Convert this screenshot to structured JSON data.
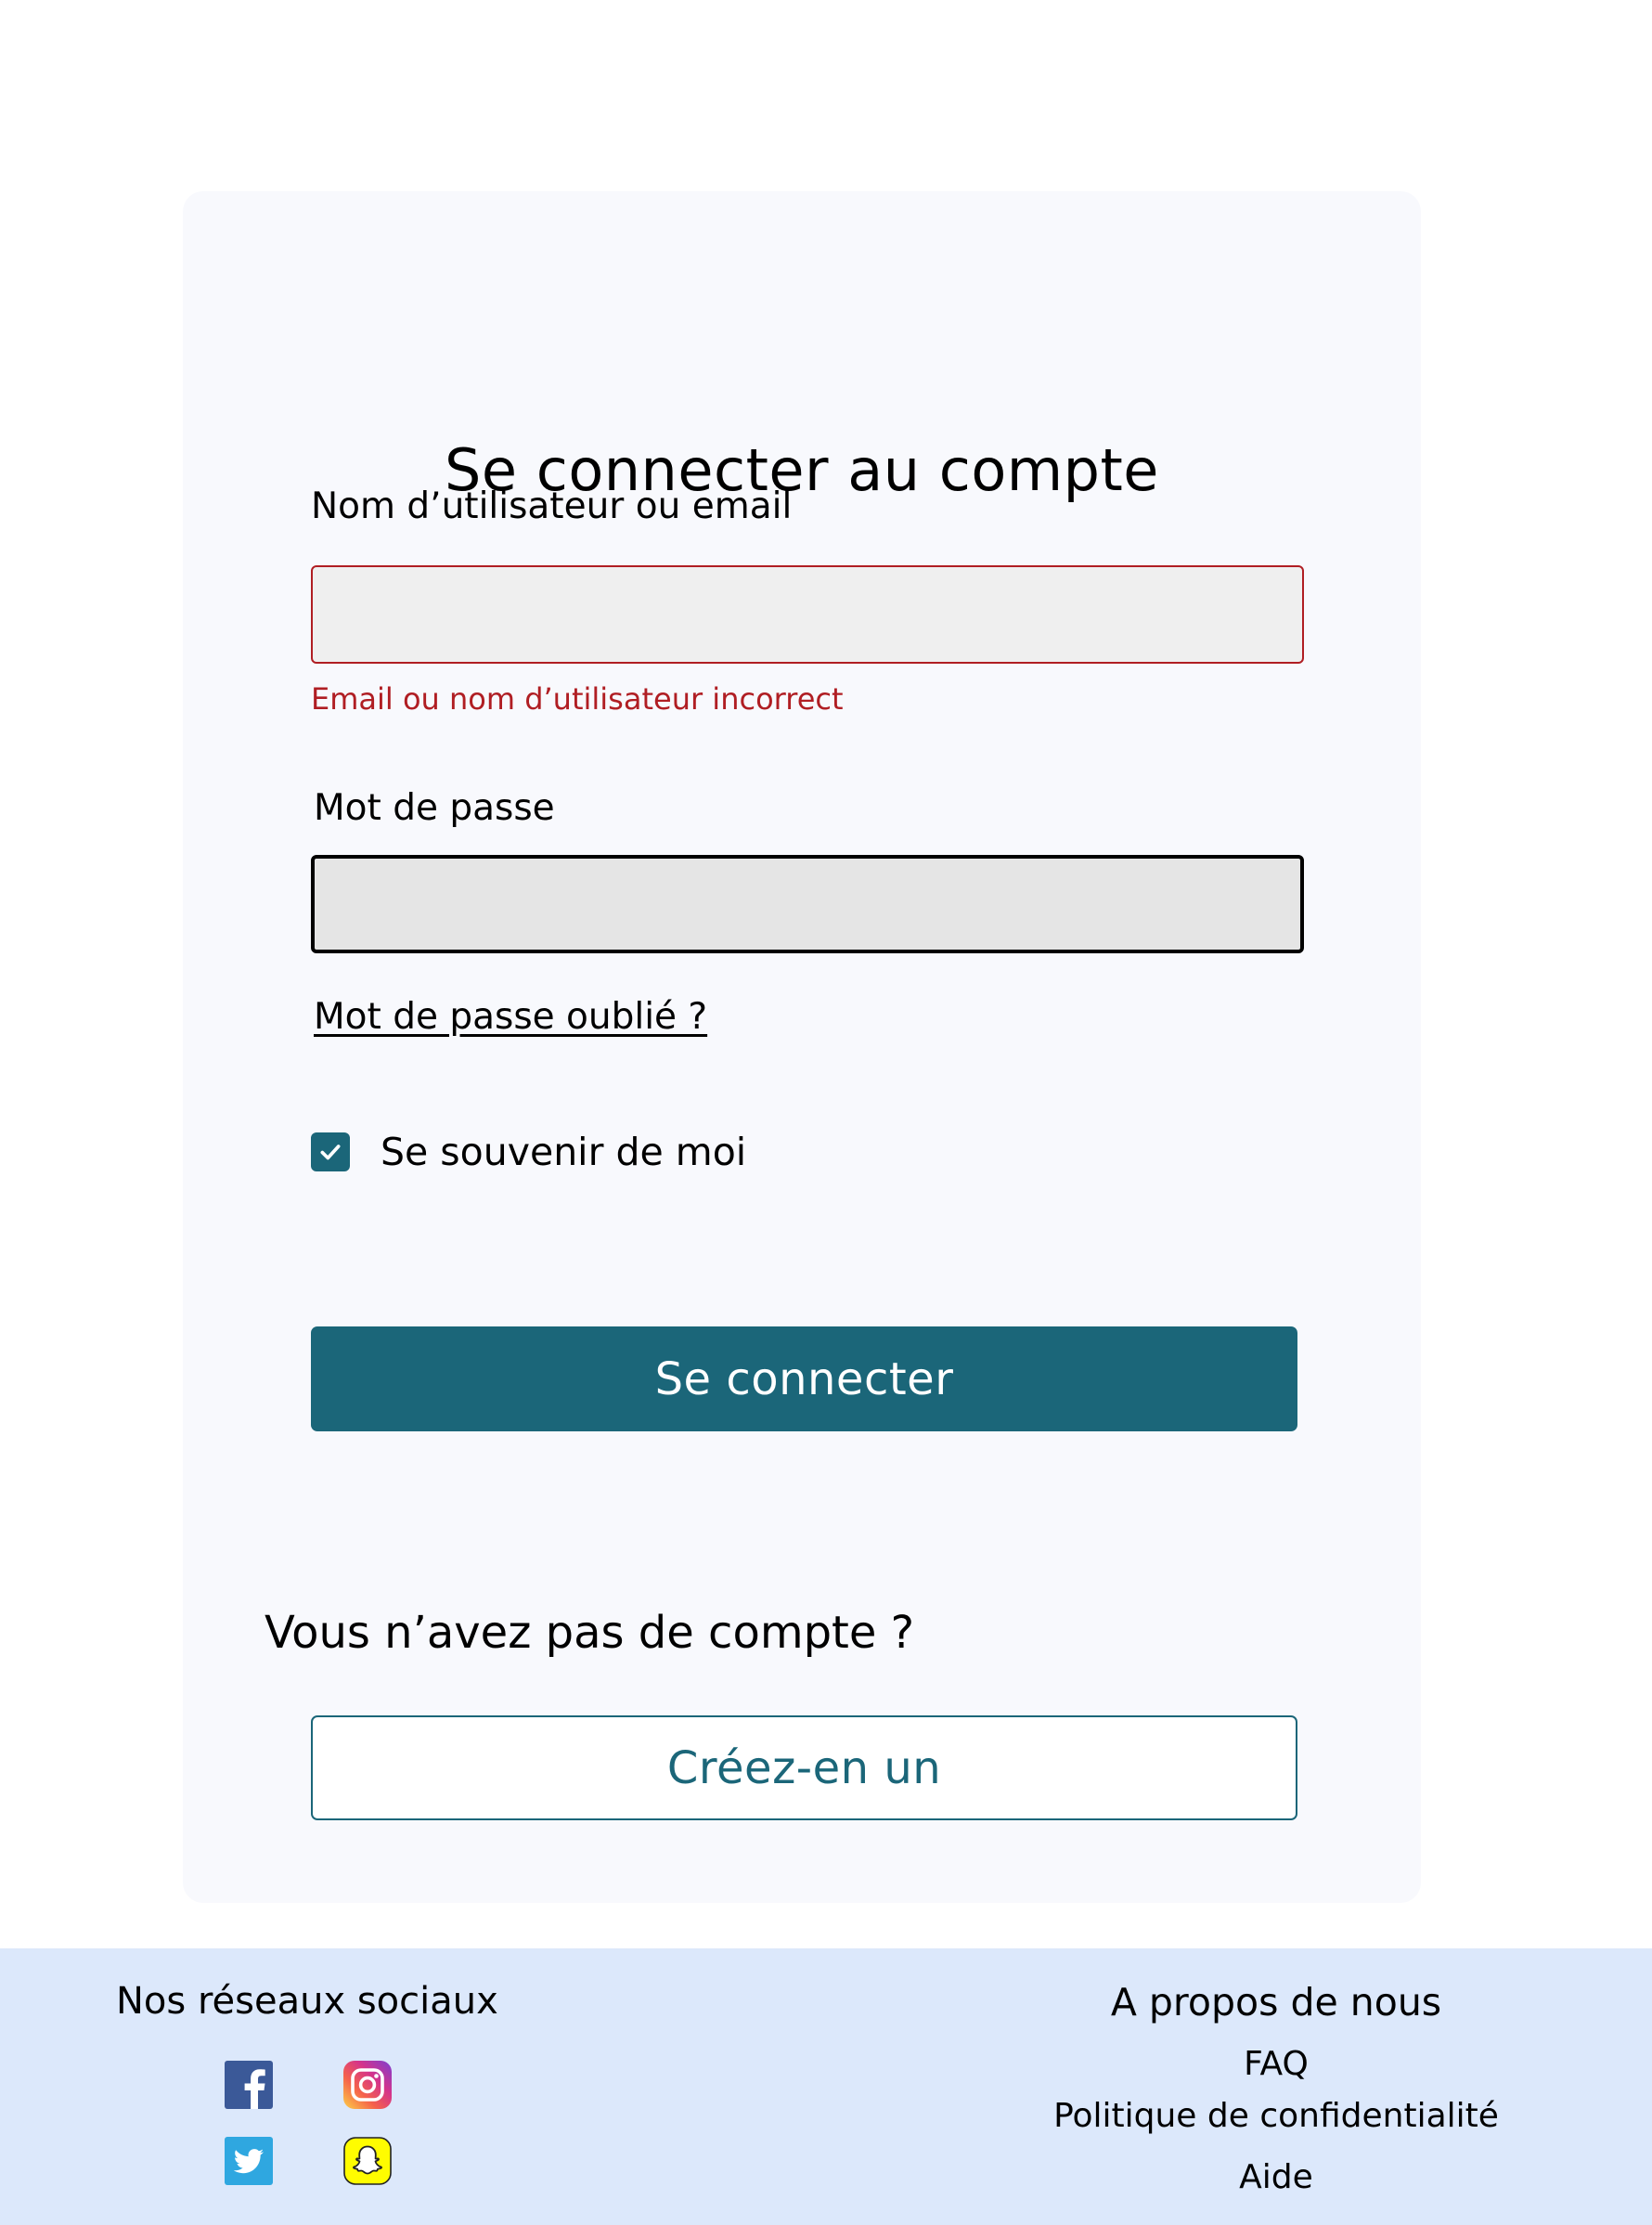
{
  "login": {
    "title": "Se connecter au compte",
    "username_label": "Nom d’utilisateur ou email",
    "username_value": "",
    "username_error": "Email ou nom d’utilisateur incorrect",
    "password_label": "Mot de passe",
    "password_value": "",
    "forgot_password": "Mot de passe oublié ?",
    "remember_me": "Se souvenir de moi",
    "remember_checked": true,
    "submit_label": "Se connecter",
    "no_account_prompt": "Vous n’avez pas de compte ?",
    "create_account_label": "Créez-en un"
  },
  "footer": {
    "social_title": "Nos réseaux sociaux",
    "social_icons": [
      "facebook-icon",
      "instagram-icon",
      "twitter-icon",
      "snapchat-icon"
    ],
    "about_title": "A propos de nous",
    "links": [
      "FAQ",
      "Politique de confidentialité",
      "Aide"
    ]
  },
  "colors": {
    "primary": "#1b6679",
    "error": "#b01e23",
    "card_background": "#f8f9fd",
    "footer_background": "#dce8fb",
    "facebook": "#3b5998",
    "twitter": "#2fa7e0",
    "snapchat": "#fffc00"
  }
}
